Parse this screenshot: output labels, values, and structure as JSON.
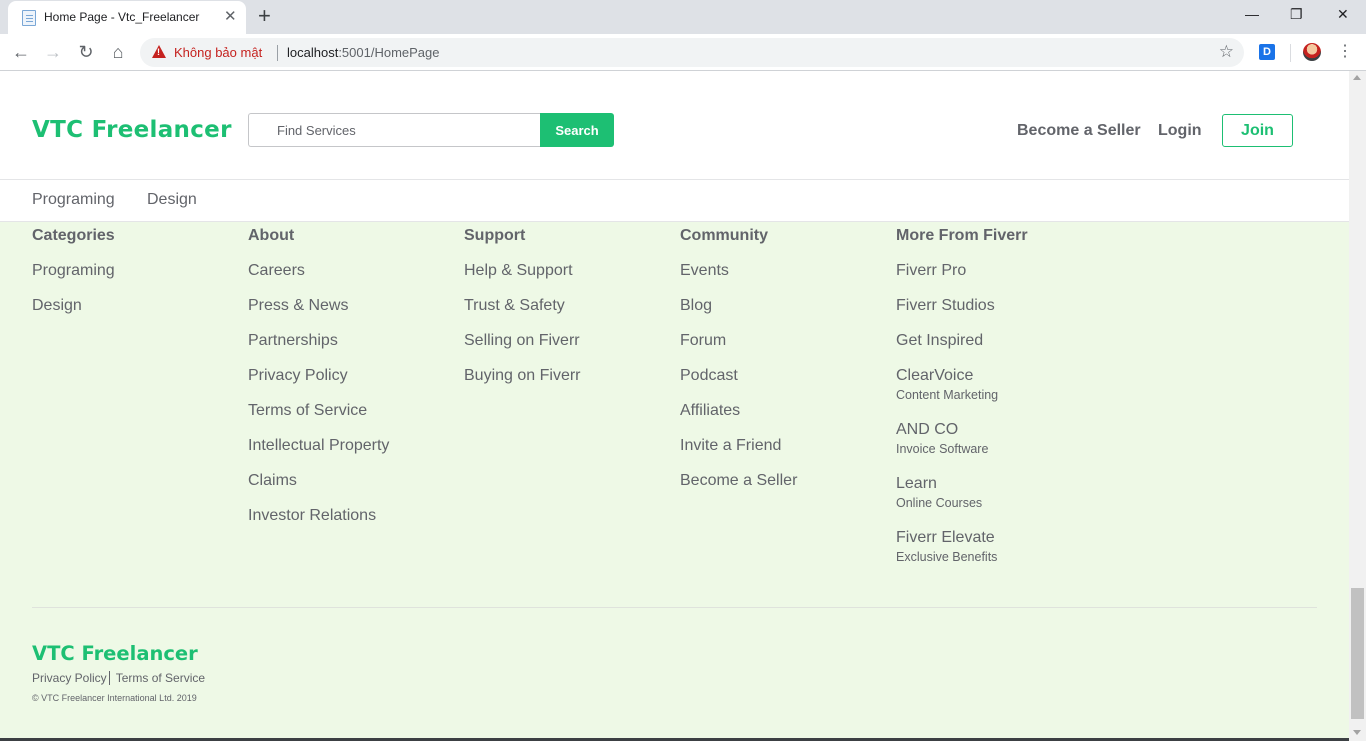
{
  "browser": {
    "tab_title": "Home Page - Vtc_Freelancer",
    "security_label": "Không bảo mật",
    "url_host": "localhost",
    "url_rest": ":5001/HomePage",
    "extension_label": "D"
  },
  "header": {
    "logo": "VTC Freelancer",
    "search_placeholder": "Find Services",
    "search_button": "Search",
    "become_seller": "Become a Seller",
    "login": "Login",
    "join": "Join"
  },
  "category_nav": [
    "Programing",
    "Design"
  ],
  "footer": {
    "columns": [
      {
        "title": "Categories",
        "links": [
          {
            "label": "Programing"
          },
          {
            "label": "Design"
          }
        ]
      },
      {
        "title": "About",
        "links": [
          {
            "label": "Careers"
          },
          {
            "label": "Press & News"
          },
          {
            "label": "Partnerships"
          },
          {
            "label": "Privacy Policy"
          },
          {
            "label": "Terms of Service"
          },
          {
            "label": "Intellectual Property"
          },
          {
            "label": "Claims"
          },
          {
            "label": "Investor Relations"
          }
        ]
      },
      {
        "title": "Support",
        "links": [
          {
            "label": "Help & Support"
          },
          {
            "label": "Trust & Safety"
          },
          {
            "label": "Selling on Fiverr"
          },
          {
            "label": "Buying on Fiverr"
          }
        ]
      },
      {
        "title": "Community",
        "links": [
          {
            "label": "Events"
          },
          {
            "label": "Blog"
          },
          {
            "label": "Forum"
          },
          {
            "label": "Podcast"
          },
          {
            "label": "Affiliates"
          },
          {
            "label": "Invite a Friend"
          },
          {
            "label": "Become a Seller"
          }
        ]
      },
      {
        "title": "More From Fiverr",
        "links": [
          {
            "label": "Fiverr Pro"
          },
          {
            "label": "Fiverr Studios"
          },
          {
            "label": "Get Inspired"
          },
          {
            "label": "ClearVoice",
            "sub": "Content Marketing"
          },
          {
            "label": "AND CO",
            "sub": "Invoice Software"
          },
          {
            "label": "Learn",
            "sub": "Online Courses"
          },
          {
            "label": "Fiverr Elevate",
            "sub": "Exclusive Benefits"
          }
        ]
      }
    ],
    "logo": "VTC Freelancer",
    "privacy_policy": "Privacy Policy",
    "terms_of_service": "Terms of Service",
    "copyright": "© VTC Freelancer International Ltd. 2019"
  }
}
